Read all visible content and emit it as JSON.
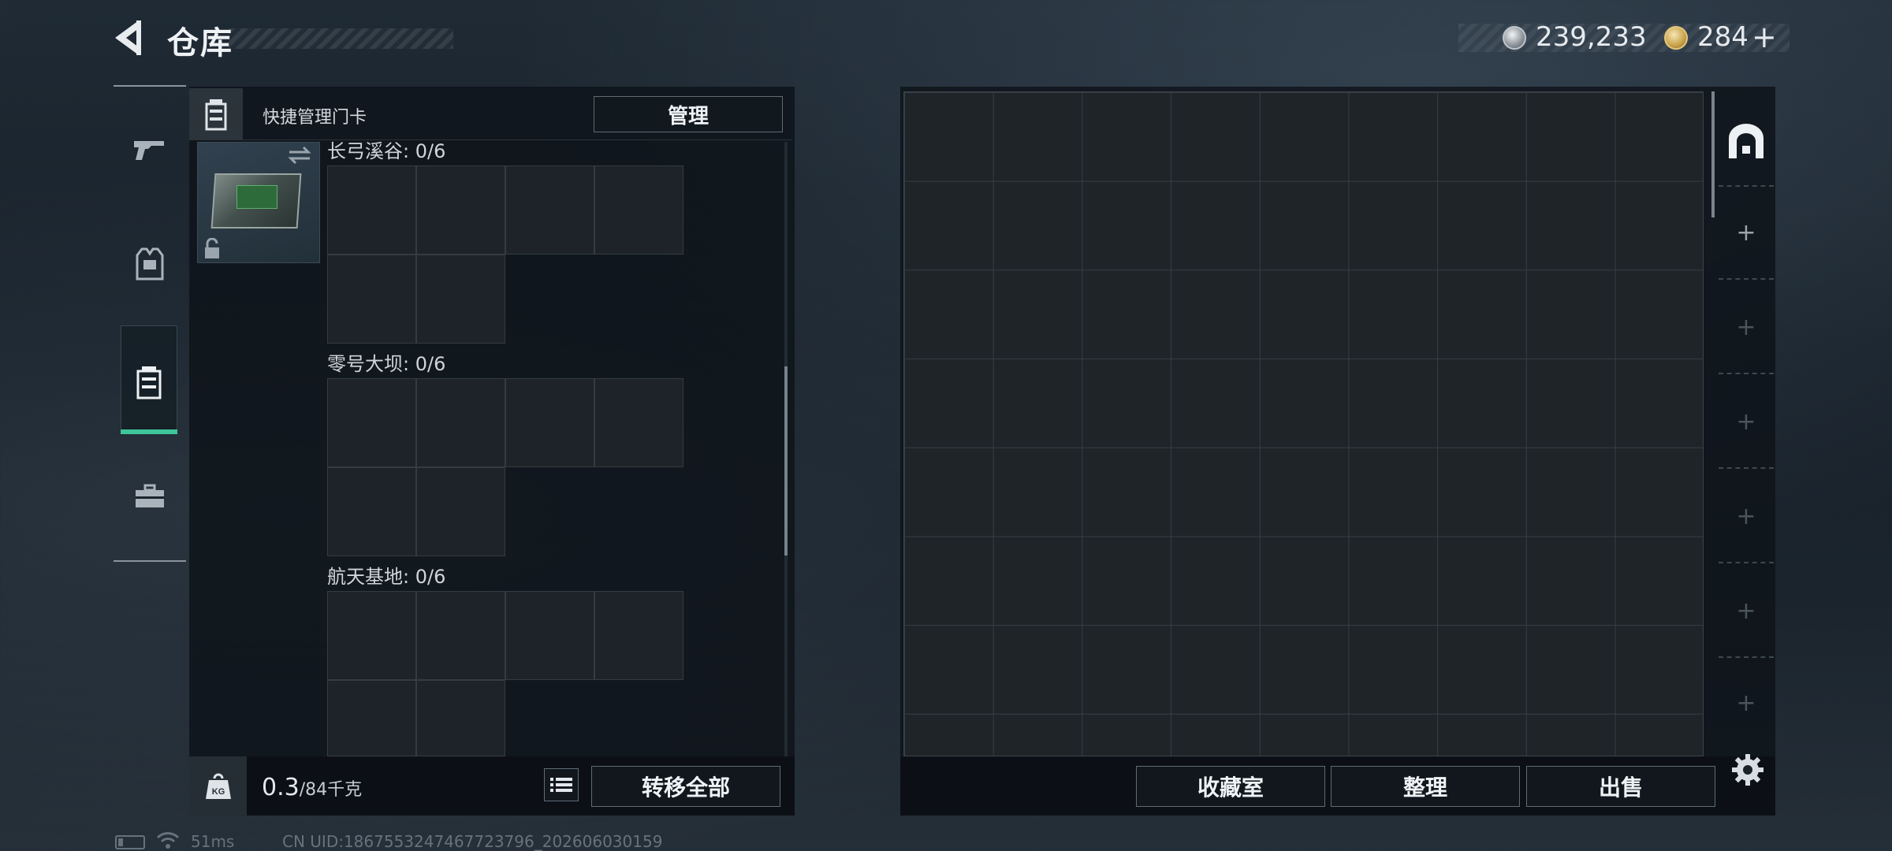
{
  "header": {
    "title": "仓库",
    "back_icon": "back-chevron-icon"
  },
  "currency": {
    "silver": "239,233",
    "gold": "284",
    "gold_add": "+"
  },
  "sidebar": {
    "items": [
      {
        "name": "weapons",
        "icon": "gun-icon"
      },
      {
        "name": "equipment",
        "icon": "vest-icon"
      },
      {
        "name": "key-cards",
        "icon": "keycard-case-icon",
        "active": true
      },
      {
        "name": "toolbox",
        "icon": "briefcase-icon"
      }
    ],
    "active_color": "#3fc59a"
  },
  "left_panel": {
    "quick_manage_label": "快捷管理门卡",
    "manage_button": "管理",
    "regions": [
      {
        "label": "长弓溪谷: 0/6"
      },
      {
        "label": "零号大坝: 0/6"
      },
      {
        "label": "航天基地: 0/6"
      }
    ],
    "weight": {
      "current": "0.3",
      "max": "/84千克",
      "icon_label": "KG"
    },
    "transfer_all_button": "转移全部"
  },
  "right_panel": {
    "buttons": {
      "collection_room": "收藏室",
      "organize": "整理",
      "sell": "出售"
    },
    "side_tabs": [
      "+",
      "+",
      "+",
      "+",
      "+",
      "+",
      "+"
    ]
  },
  "status": {
    "ping": "51ms",
    "uid": "CN UID:1867553247467723796_202606030159"
  }
}
